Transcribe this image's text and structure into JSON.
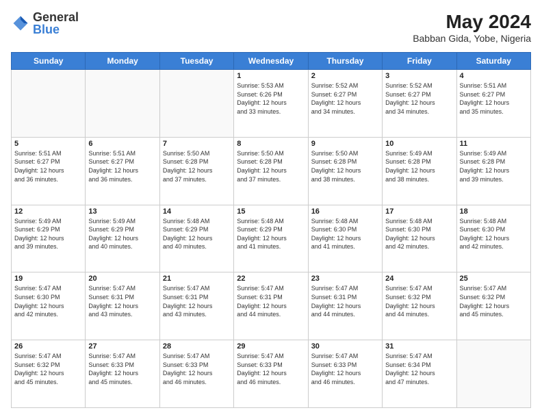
{
  "header": {
    "logo_general": "General",
    "logo_blue": "Blue",
    "month_year": "May 2024",
    "location": "Babban Gida, Yobe, Nigeria"
  },
  "days_of_week": [
    "Sunday",
    "Monday",
    "Tuesday",
    "Wednesday",
    "Thursday",
    "Friday",
    "Saturday"
  ],
  "weeks": [
    [
      {
        "day": "",
        "info": ""
      },
      {
        "day": "",
        "info": ""
      },
      {
        "day": "",
        "info": ""
      },
      {
        "day": "1",
        "info": "Sunrise: 5:53 AM\nSunset: 6:26 PM\nDaylight: 12 hours\nand 33 minutes."
      },
      {
        "day": "2",
        "info": "Sunrise: 5:52 AM\nSunset: 6:27 PM\nDaylight: 12 hours\nand 34 minutes."
      },
      {
        "day": "3",
        "info": "Sunrise: 5:52 AM\nSunset: 6:27 PM\nDaylight: 12 hours\nand 34 minutes."
      },
      {
        "day": "4",
        "info": "Sunrise: 5:51 AM\nSunset: 6:27 PM\nDaylight: 12 hours\nand 35 minutes."
      }
    ],
    [
      {
        "day": "5",
        "info": "Sunrise: 5:51 AM\nSunset: 6:27 PM\nDaylight: 12 hours\nand 36 minutes."
      },
      {
        "day": "6",
        "info": "Sunrise: 5:51 AM\nSunset: 6:27 PM\nDaylight: 12 hours\nand 36 minutes."
      },
      {
        "day": "7",
        "info": "Sunrise: 5:50 AM\nSunset: 6:28 PM\nDaylight: 12 hours\nand 37 minutes."
      },
      {
        "day": "8",
        "info": "Sunrise: 5:50 AM\nSunset: 6:28 PM\nDaylight: 12 hours\nand 37 minutes."
      },
      {
        "day": "9",
        "info": "Sunrise: 5:50 AM\nSunset: 6:28 PM\nDaylight: 12 hours\nand 38 minutes."
      },
      {
        "day": "10",
        "info": "Sunrise: 5:49 AM\nSunset: 6:28 PM\nDaylight: 12 hours\nand 38 minutes."
      },
      {
        "day": "11",
        "info": "Sunrise: 5:49 AM\nSunset: 6:28 PM\nDaylight: 12 hours\nand 39 minutes."
      }
    ],
    [
      {
        "day": "12",
        "info": "Sunrise: 5:49 AM\nSunset: 6:29 PM\nDaylight: 12 hours\nand 39 minutes."
      },
      {
        "day": "13",
        "info": "Sunrise: 5:49 AM\nSunset: 6:29 PM\nDaylight: 12 hours\nand 40 minutes."
      },
      {
        "day": "14",
        "info": "Sunrise: 5:48 AM\nSunset: 6:29 PM\nDaylight: 12 hours\nand 40 minutes."
      },
      {
        "day": "15",
        "info": "Sunrise: 5:48 AM\nSunset: 6:29 PM\nDaylight: 12 hours\nand 41 minutes."
      },
      {
        "day": "16",
        "info": "Sunrise: 5:48 AM\nSunset: 6:30 PM\nDaylight: 12 hours\nand 41 minutes."
      },
      {
        "day": "17",
        "info": "Sunrise: 5:48 AM\nSunset: 6:30 PM\nDaylight: 12 hours\nand 42 minutes."
      },
      {
        "day": "18",
        "info": "Sunrise: 5:48 AM\nSunset: 6:30 PM\nDaylight: 12 hours\nand 42 minutes."
      }
    ],
    [
      {
        "day": "19",
        "info": "Sunrise: 5:47 AM\nSunset: 6:30 PM\nDaylight: 12 hours\nand 42 minutes."
      },
      {
        "day": "20",
        "info": "Sunrise: 5:47 AM\nSunset: 6:31 PM\nDaylight: 12 hours\nand 43 minutes."
      },
      {
        "day": "21",
        "info": "Sunrise: 5:47 AM\nSunset: 6:31 PM\nDaylight: 12 hours\nand 43 minutes."
      },
      {
        "day": "22",
        "info": "Sunrise: 5:47 AM\nSunset: 6:31 PM\nDaylight: 12 hours\nand 44 minutes."
      },
      {
        "day": "23",
        "info": "Sunrise: 5:47 AM\nSunset: 6:31 PM\nDaylight: 12 hours\nand 44 minutes."
      },
      {
        "day": "24",
        "info": "Sunrise: 5:47 AM\nSunset: 6:32 PM\nDaylight: 12 hours\nand 44 minutes."
      },
      {
        "day": "25",
        "info": "Sunrise: 5:47 AM\nSunset: 6:32 PM\nDaylight: 12 hours\nand 45 minutes."
      }
    ],
    [
      {
        "day": "26",
        "info": "Sunrise: 5:47 AM\nSunset: 6:32 PM\nDaylight: 12 hours\nand 45 minutes."
      },
      {
        "day": "27",
        "info": "Sunrise: 5:47 AM\nSunset: 6:33 PM\nDaylight: 12 hours\nand 45 minutes."
      },
      {
        "day": "28",
        "info": "Sunrise: 5:47 AM\nSunset: 6:33 PM\nDaylight: 12 hours\nand 46 minutes."
      },
      {
        "day": "29",
        "info": "Sunrise: 5:47 AM\nSunset: 6:33 PM\nDaylight: 12 hours\nand 46 minutes."
      },
      {
        "day": "30",
        "info": "Sunrise: 5:47 AM\nSunset: 6:33 PM\nDaylight: 12 hours\nand 46 minutes."
      },
      {
        "day": "31",
        "info": "Sunrise: 5:47 AM\nSunset: 6:34 PM\nDaylight: 12 hours\nand 47 minutes."
      },
      {
        "day": "",
        "info": ""
      }
    ]
  ]
}
